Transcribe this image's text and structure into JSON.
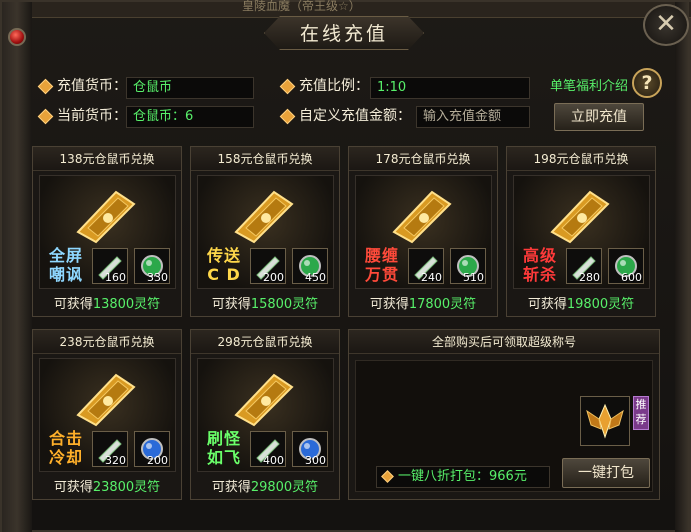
{
  "top_text": "皇陵血魔（帝王级☆）",
  "window": {
    "title": "在线充值",
    "close_icon": "✕"
  },
  "form": {
    "currency_label": "充值货币：",
    "currency_value": "仓鼠币",
    "current_label": "当前货币：",
    "current_value": "仓鼠币：6",
    "ratio_label": "充值比例：",
    "ratio_value": "1:10",
    "custom_label": "自定义充值金额：",
    "custom_placeholder": "输入充值金额",
    "benefit_link": "单笔福利介绍",
    "help_icon": "?",
    "recharge_button": "立即充值"
  },
  "cards": [
    {
      "title": "138元仓鼠币兑换",
      "tag": [
        "全屏",
        "嘲讽"
      ],
      "tag_color": "#8fd8ff",
      "slot1": "160",
      "slot2": "330",
      "reward_prefix": "可获得",
      "reward_amount": "13800灵符"
    },
    {
      "title": "158元仓鼠币兑换",
      "tag": [
        "传送",
        "C D"
      ],
      "tag_color": "#ffd84a",
      "slot1": "200",
      "slot2": "450",
      "reward_prefix": "可获得",
      "reward_amount": "15800灵符"
    },
    {
      "title": "178元仓鼠币兑换",
      "tag": [
        "腰缠",
        "万贯"
      ],
      "tag_color": "#ff4a3a",
      "slot1": "240",
      "slot2": "510",
      "reward_prefix": "可获得",
      "reward_amount": "17800灵符"
    },
    {
      "title": "198元仓鼠币兑换",
      "tag": [
        "高级",
        "斩杀"
      ],
      "tag_color": "#ff3a3a",
      "slot1": "280",
      "slot2": "600",
      "reward_prefix": "可获得",
      "reward_amount": "19800灵符"
    },
    {
      "title": "238元仓鼠币兑换",
      "tag": [
        "合击",
        "冷却"
      ],
      "tag_color": "#ffb02a",
      "slot1": "320",
      "slot2": "200",
      "reward_prefix": "可获得",
      "reward_amount": "23800灵符"
    },
    {
      "title": "298元仓鼠币兑换",
      "tag": [
        "刷怪",
        "如飞"
      ],
      "tag_color": "#6aff6a",
      "slot1": "400",
      "slot2": "300",
      "reward_prefix": "可获得",
      "reward_amount": "29800灵符"
    }
  ],
  "special": {
    "title": "全部购买后可领取超级称号",
    "recommend_badge": "推荐",
    "package_text": "一键八折打包：966元",
    "package_button": "一键打包"
  }
}
